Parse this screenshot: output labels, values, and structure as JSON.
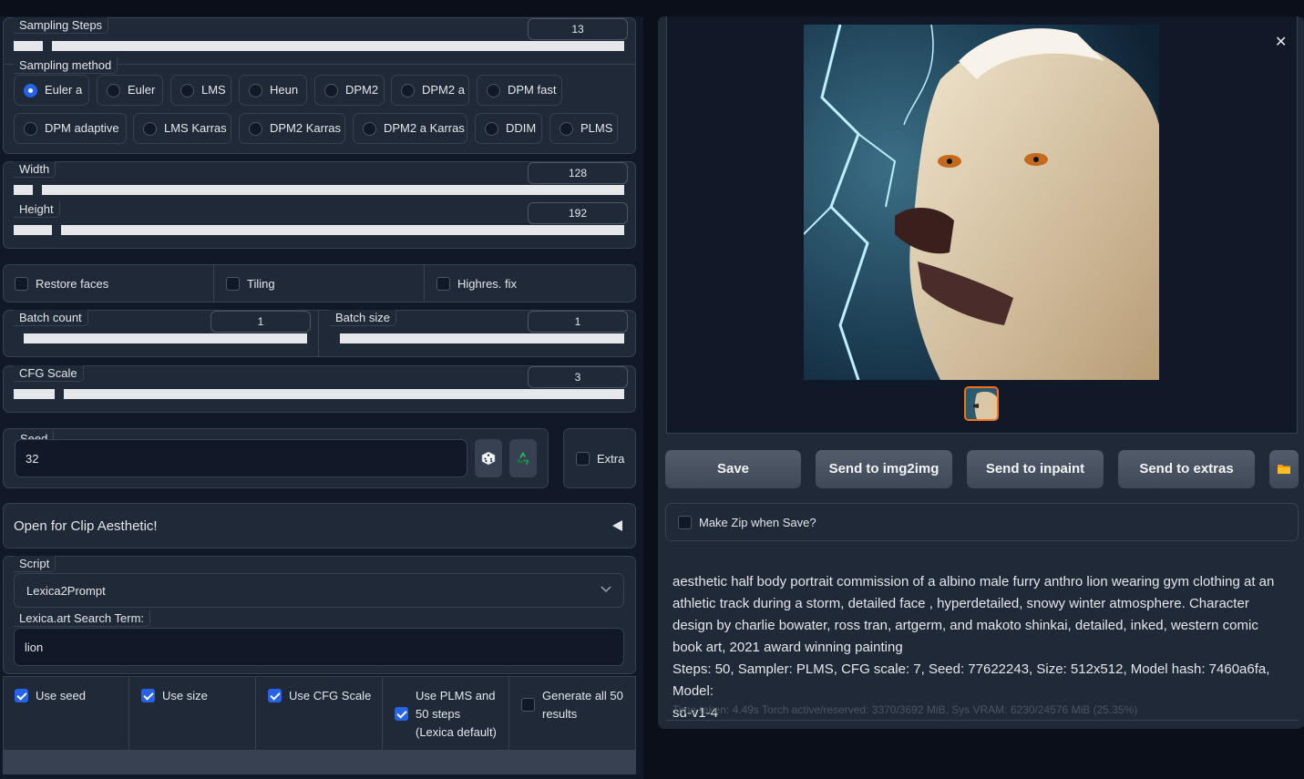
{
  "sampling_steps": {
    "label": "Sampling Steps",
    "value": "13",
    "fraction": 0.08
  },
  "sampling_method": {
    "label": "Sampling method",
    "options": [
      "Euler a",
      "Euler",
      "LMS",
      "Heun",
      "DPM2",
      "DPM2 a",
      "DPM fast",
      "DPM adaptive",
      "LMS Karras",
      "DPM2 Karras",
      "DPM2 a Karras",
      "DDIM",
      "PLMS"
    ],
    "selected": "Euler a"
  },
  "width": {
    "label": "Width",
    "value": "128",
    "fraction": 0.03
  },
  "height": {
    "label": "Height",
    "value": "192",
    "fraction": 0.06
  },
  "toggles": {
    "restore_faces": "Restore faces",
    "tiling": "Tiling",
    "highres_fix": "Highres. fix"
  },
  "batch_count": {
    "label": "Batch count",
    "value": "1",
    "fraction": 0.0
  },
  "batch_size": {
    "label": "Batch size",
    "value": "1",
    "fraction": 0.0
  },
  "cfg_scale": {
    "label": "CFG Scale",
    "value": "3",
    "fraction": 0.07
  },
  "seed": {
    "label": "Seed",
    "value": "32",
    "extra_label": "Extra",
    "random_icon": "dice-icon",
    "reuse_icon": "recycle-icon"
  },
  "clip_aesthetic": {
    "label": "Open for Clip Aesthetic!",
    "icon": "triangle-left-icon"
  },
  "script": {
    "label": "Script",
    "value": "Lexica2Prompt",
    "icon": "chevron-down-icon"
  },
  "lexica": {
    "label": "Lexica.art Search Term:",
    "value": "lion"
  },
  "options": {
    "use_seed": "Use seed",
    "use_size": "Use size",
    "use_cfg": "Use CFG Scale",
    "use_plms": [
      "Use PLMS and",
      "50 steps",
      "(Lexica default)"
    ],
    "generate_all": [
      "Generate all 50",
      "results"
    ]
  },
  "output": {
    "close_icon": "close-icon",
    "buttons": {
      "save": "Save",
      "img2img": "Send to img2img",
      "inpaint": "Send to inpaint",
      "extras": "Send to extras"
    },
    "folder_icon": "folder-icon",
    "make_zip": "Make Zip when Save?",
    "prompt": [
      "aesthetic half body portrait commission of a albino male furry anthro lion wearing gym clothing at an",
      "athletic track during a storm, detailed face , hyperdetailed, snowy winter atmosphere. Character",
      "design by charlie bowater, ross tran, artgerm, and makoto shinkai, detailed, inked, western comic",
      "book art, 2021 award winning painting"
    ],
    "params": [
      "Steps: 50, Sampler: PLMS, CFG scale: 7, Seed: 77622243, Size: 512x512, Model hash: 7460a6fa, Model:",
      "sd-v1-4"
    ],
    "timing": "Time taken: 4.49s  Torch active/reserved: 3370/3692 MiB, Sys VRAM: 6230/24576 MiB (25.35%)"
  }
}
